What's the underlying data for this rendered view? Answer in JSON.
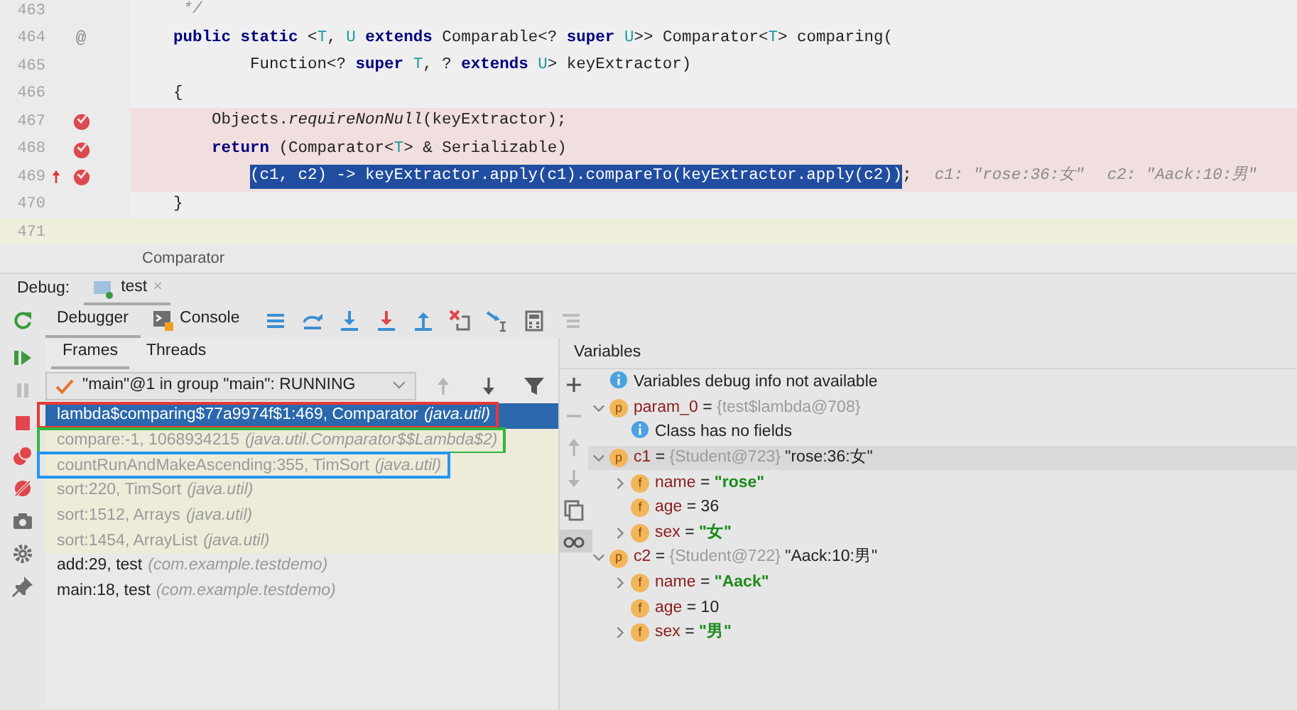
{
  "editor": {
    "lines": [
      {
        "number": "463",
        "current": false,
        "breakpoint": false,
        "step_marker": false,
        "tokens": [
          {
            "text": "     */",
            "kind": "comment"
          }
        ]
      },
      {
        "number": "464",
        "current": false,
        "mark": "@",
        "breakpoint": false,
        "step_marker": false,
        "tokens": [
          {
            "text": "    public static",
            "kind": "keyword"
          },
          {
            "text": " <",
            "kind": "plain"
          },
          {
            "text": "T",
            "kind": "typeparam"
          },
          {
            "text": ", ",
            "kind": "plain"
          },
          {
            "text": "U",
            "kind": "typeparam"
          },
          {
            "text": " extends",
            "kind": "keyword"
          },
          {
            "text": " Comparable<? ",
            "kind": "plain"
          },
          {
            "text": "super",
            "kind": "keyword"
          },
          {
            "text": " U",
            "kind": "typeparam"
          },
          {
            "text": ">> Comparator<",
            "kind": "plain"
          },
          {
            "text": "T",
            "kind": "typeparam"
          },
          {
            "text": "> comparing(",
            "kind": "plain"
          }
        ]
      },
      {
        "number": "465",
        "current": false,
        "breakpoint": false,
        "step_marker": false,
        "tokens": [
          {
            "text": "            Function<? ",
            "kind": "plain"
          },
          {
            "text": "super",
            "kind": "keyword"
          },
          {
            "text": " T",
            "kind": "typeparam"
          },
          {
            "text": ", ? ",
            "kind": "plain"
          },
          {
            "text": "extends",
            "kind": "keyword"
          },
          {
            "text": " U",
            "kind": "typeparam"
          },
          {
            "text": "> keyExtractor)",
            "kind": "plain"
          }
        ]
      },
      {
        "number": "466",
        "current": false,
        "breakpoint": false,
        "step_marker": false,
        "tokens": [
          {
            "text": "    {",
            "kind": "plain"
          }
        ]
      },
      {
        "number": "467",
        "current": false,
        "breakpoint": true,
        "step_marker": false,
        "tokens": [
          {
            "text": "        Objects.",
            "kind": "plain"
          },
          {
            "text": "requireNonNull",
            "kind": "italic"
          },
          {
            "text": "(keyExtractor);",
            "kind": "plain"
          }
        ]
      },
      {
        "number": "468",
        "current": false,
        "breakpoint": true,
        "step_marker": false,
        "tokens": [
          {
            "text": "        return",
            "kind": "keyword"
          },
          {
            "text": " (Comparator<",
            "kind": "plain"
          },
          {
            "text": "T",
            "kind": "typeparam"
          },
          {
            "text": "> & Serializable)",
            "kind": "plain"
          }
        ]
      },
      {
        "number": "469",
        "current": false,
        "breakpoint": true,
        "step_marker": true,
        "tokens": [
          {
            "text": "            (c1, c2) -> keyExtractor.apply(c1).compareTo(keyExtractor.apply(c2))",
            "kind": "selected"
          },
          {
            "text": ";",
            "kind": "plain"
          },
          {
            "text": "c1: \"rose:36:女\"",
            "kind": "hint"
          },
          {
            "text": "c2: \"Aack:10:男\"",
            "kind": "hint"
          }
        ]
      },
      {
        "number": "470",
        "current": false,
        "breakpoint": false,
        "step_marker": false,
        "tokens": [
          {
            "text": "    }",
            "kind": "plain"
          }
        ]
      },
      {
        "number": "471",
        "current": true,
        "breakpoint": false,
        "step_marker": false
      }
    ]
  },
  "breadcrumb": "Comparator",
  "debug": {
    "label": "Debug:",
    "tabs": [
      {
        "label": "test",
        "selected": true,
        "close": "×"
      }
    ],
    "view_tabs": [
      {
        "label": "Debugger",
        "kind": "debugger",
        "selected": true
      },
      {
        "label": "Console",
        "kind": "console",
        "selected": false
      }
    ],
    "toolbar": [
      {
        "kind": "executionpoint",
        "disabled": false
      },
      {
        "kind": "stepover",
        "disabled": false
      },
      {
        "kind": "stepinto",
        "disabled": false
      },
      {
        "kind": "forcestepinto",
        "disabled": false
      },
      {
        "kind": "stepout",
        "disabled": false
      },
      {
        "kind": "dropframe",
        "disabled": false
      },
      {
        "kind": "runtocursor",
        "disabled": false
      },
      {
        "kind": "evaluate",
        "disabled": false
      },
      {
        "kind": "trace",
        "disabled": true
      }
    ],
    "side_tools": [
      {
        "kind": "rerun",
        "disabled": false
      },
      {
        "kind": "resume",
        "disabled": false
      },
      {
        "kind": "pause",
        "disabled": true
      },
      {
        "kind": "stop",
        "disabled": false
      },
      {
        "kind": "breakpoints",
        "disabled": false
      },
      {
        "kind": "mute",
        "disabled": false
      },
      {
        "kind": "camera",
        "disabled": false
      },
      {
        "kind": "settings",
        "disabled": false
      },
      {
        "kind": "pin",
        "disabled": false
      }
    ],
    "frames": {
      "tabs": [
        {
          "label": "Frames",
          "selected": true
        },
        {
          "label": "Threads",
          "selected": false
        }
      ],
      "thread": "\"main\"@1 in group \"main\": RUNNING",
      "tools": [
        {
          "kind": "up",
          "disabled": true
        },
        {
          "kind": "down",
          "disabled": false
        },
        {
          "kind": "filter",
          "disabled": false
        }
      ],
      "rows": [
        {
          "method": "lambda$comparing$77a9974f$1:469, Comparator",
          "package": "(java.util)",
          "selected": true,
          "library": false,
          "color": "#e53935"
        },
        {
          "method": "compare:-1, 1068934215",
          "package": "(java.util.Comparator$$Lambda$2)",
          "selected": false,
          "library": true,
          "color": "#2db83d"
        },
        {
          "method": "countRunAndMakeAscending:355, TimSort",
          "package": "(java.util)",
          "selected": false,
          "library": true,
          "color": "#2196f3"
        },
        {
          "method": "sort:220, TimSort",
          "package": "(java.util)",
          "selected": false,
          "library": true
        },
        {
          "method": "sort:1512, Arrays",
          "package": "(java.util)",
          "selected": false,
          "library": true
        },
        {
          "method": "sort:1454, ArrayList",
          "package": "(java.util)",
          "selected": false,
          "library": true
        },
        {
          "method": "add:29, test",
          "package": "(com.example.testdemo)",
          "selected": false,
          "library": false
        },
        {
          "method": "main:18, test",
          "package": "(com.example.testdemo)",
          "selected": false,
          "library": false
        }
      ]
    },
    "variables": {
      "title": "Variables",
      "tools": [
        {
          "kind": "add",
          "disabled": false
        },
        {
          "kind": "remove",
          "disabled": true
        },
        {
          "kind": "up",
          "disabled": true
        },
        {
          "kind": "down",
          "disabled": true
        },
        {
          "kind": "copy",
          "disabled": false
        },
        {
          "kind": "watches",
          "disabled": false
        }
      ],
      "tree": [
        {
          "kind": "info",
          "text": "Variables debug info not available"
        },
        {
          "kind": "param",
          "badge": "p",
          "name": "param_0",
          "eq": "=",
          "ref": "{test$lambda@708}",
          "expanded": true,
          "selected": false,
          "children": [
            {
              "kind": "info",
              "text": "Class has no fields"
            }
          ]
        },
        {
          "kind": "param",
          "badge": "p",
          "name": "c1",
          "eq": "=",
          "ref": "{Student@723}",
          "value": "\"rose:36:女\"",
          "is_string": false,
          "expanded": true,
          "selected": true,
          "children": [
            {
              "kind": "field",
              "badge": "f",
              "name": "name",
              "eq": "=",
              "value": "\"rose\"",
              "is_string": true,
              "expanded": false,
              "selected": false
            },
            {
              "kind": "field",
              "badge": "f",
              "name": "age",
              "eq": "=",
              "value": "36",
              "is_string": false,
              "selected": false
            },
            {
              "kind": "field",
              "badge": "f",
              "name": "sex",
              "eq": "=",
              "value": "\"女\"",
              "is_string": true,
              "expanded": false,
              "selected": false
            }
          ]
        },
        {
          "kind": "param",
          "badge": "p",
          "name": "c2",
          "eq": "=",
          "ref": "{Student@722}",
          "value": "\"Aack:10:男\"",
          "is_string": false,
          "expanded": true,
          "selected": false,
          "children": [
            {
              "kind": "field",
              "badge": "f",
              "name": "name",
              "eq": "=",
              "value": "\"Aack\"",
              "is_string": true,
              "expanded": false,
              "selected": false
            },
            {
              "kind": "field",
              "badge": "f",
              "name": "age",
              "eq": "=",
              "value": "10",
              "is_string": false,
              "selected": false
            },
            {
              "kind": "field",
              "badge": "f",
              "name": "sex",
              "eq": "=",
              "value": "\"男\"",
              "is_string": true,
              "expanded": false,
              "selected": false
            }
          ]
        }
      ]
    }
  }
}
